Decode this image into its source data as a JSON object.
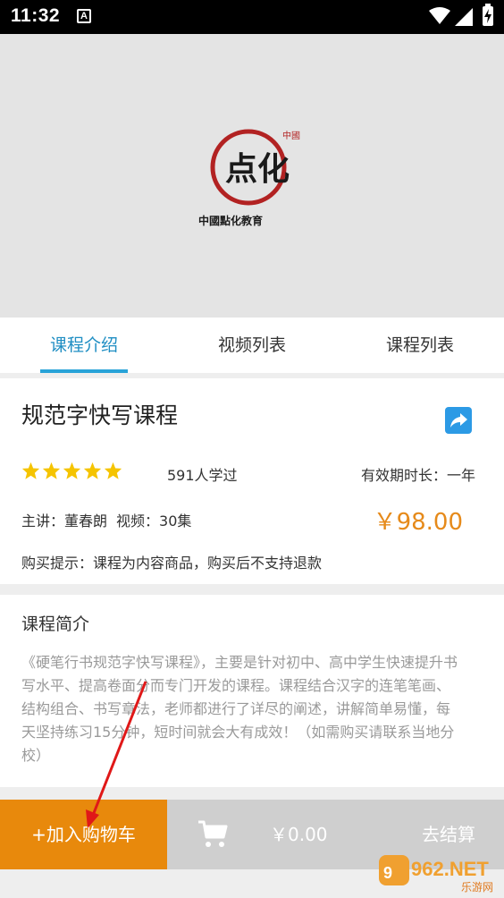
{
  "status_bar": {
    "time": "11:32",
    "notification_letter": "A"
  },
  "cover": {
    "logo_icon": "dianhua-seal-logo",
    "logo_caption": "中國點化教育",
    "logo_seal_text": "中國",
    "logo_main_text": "点化"
  },
  "tabs": [
    {
      "label": "课程介绍",
      "active": true
    },
    {
      "label": "视频列表",
      "active": false
    },
    {
      "label": "课程列表",
      "active": false
    }
  ],
  "course": {
    "title": "规范字快写课程",
    "share_icon": "share-icon",
    "rating_stars": 5,
    "rating_max": 5,
    "learners": "591人学过",
    "validity": "有效期时长：一年",
    "teacher_label": "主讲：董春朗",
    "video_label": "视频：30集",
    "price": "￥98.00",
    "purchase_tip": "购买提示：课程为内容商品，购买后不支持退款"
  },
  "intro": {
    "title": "课程简介",
    "text": "《硬笔行书规范字快写课程》，主要是针对初中、高中学生快速提升书写水平、提高卷面分而专门开发的课程。课程结合汉字的连笔笔画、结构组合、书写章法，老师都进行了详尽的阐述，讲解简单易懂，每天坚持练习15分钟，短时间就会大有成效！（如需购买请联系当地分校）"
  },
  "bottom_bar": {
    "add_to_cart": "+加入购物车",
    "cart_icon": "cart-icon",
    "cart_total": "￥0.00",
    "checkout": "去结算"
  },
  "watermark": {
    "brand": "962.NET",
    "sub": "乐游网"
  },
  "colors": {
    "accent_blue": "#29a3d8",
    "price_orange": "#e68a1a",
    "add_cart_orange": "#e8890c",
    "star_yellow": "#f5c400"
  }
}
